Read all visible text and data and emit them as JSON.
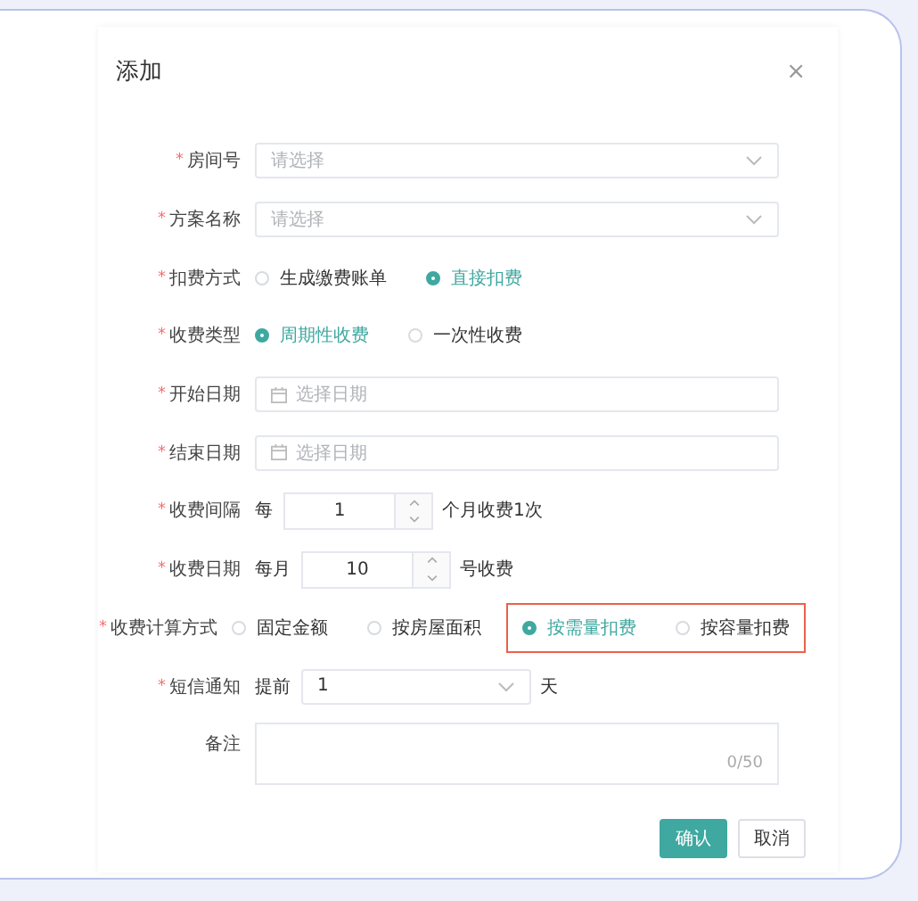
{
  "dialog": {
    "title": "添加",
    "close": "×"
  },
  "fields": [
    {
      "kind": "select",
      "label": "房间号",
      "required_mark": "*",
      "placeholder": "请选择"
    },
    {
      "kind": "select",
      "label": "方案名称",
      "required_mark": "*",
      "placeholder": "请选择"
    },
    {
      "kind": "radio",
      "label": "扣费方式",
      "required_mark": "*",
      "options": [
        {
          "label": "生成缴费账单",
          "selected": false,
          "highlighted": false
        },
        {
          "label": "直接扣费",
          "selected": true,
          "highlighted": false
        }
      ]
    },
    {
      "kind": "radio",
      "label": "收费类型",
      "required_mark": "*",
      "options": [
        {
          "label": "周期性收费",
          "selected": true,
          "highlighted": false
        },
        {
          "label": "一次性收费",
          "selected": false,
          "highlighted": false
        }
      ]
    },
    {
      "kind": "date",
      "label": "开始日期",
      "required_mark": "*",
      "placeholder": "选择日期"
    },
    {
      "kind": "date",
      "label": "结束日期",
      "required_mark": "*",
      "placeholder": "选择日期"
    },
    {
      "kind": "number",
      "label": "收费间隔",
      "required_mark": "*",
      "prefix": "每",
      "value": "1",
      "suffix": "个月收费1次"
    },
    {
      "kind": "number",
      "label": "收费日期",
      "required_mark": "*",
      "prefix": "每月",
      "value": "10",
      "suffix": "号收费"
    },
    {
      "kind": "radio",
      "label": "收费计算方式",
      "required_mark": "*",
      "options": [
        {
          "label": "固定金额",
          "selected": false,
          "highlighted": false
        },
        {
          "label": "按房屋面积",
          "selected": false,
          "highlighted": false
        },
        {
          "label": "按需量扣费",
          "selected": true,
          "highlighted": true
        },
        {
          "label": "按容量扣费",
          "selected": false,
          "highlighted": true
        }
      ]
    },
    {
      "kind": "inline-select",
      "label": "短信通知",
      "required_mark": "*",
      "prefix": "提前",
      "value": "1",
      "suffix": "天"
    },
    {
      "kind": "textarea",
      "label": "备注",
      "counter": "0/50"
    }
  ],
  "buttons": [
    {
      "label": "确认",
      "kind": "primary"
    },
    {
      "label": "取消",
      "kind": "default"
    }
  ]
}
